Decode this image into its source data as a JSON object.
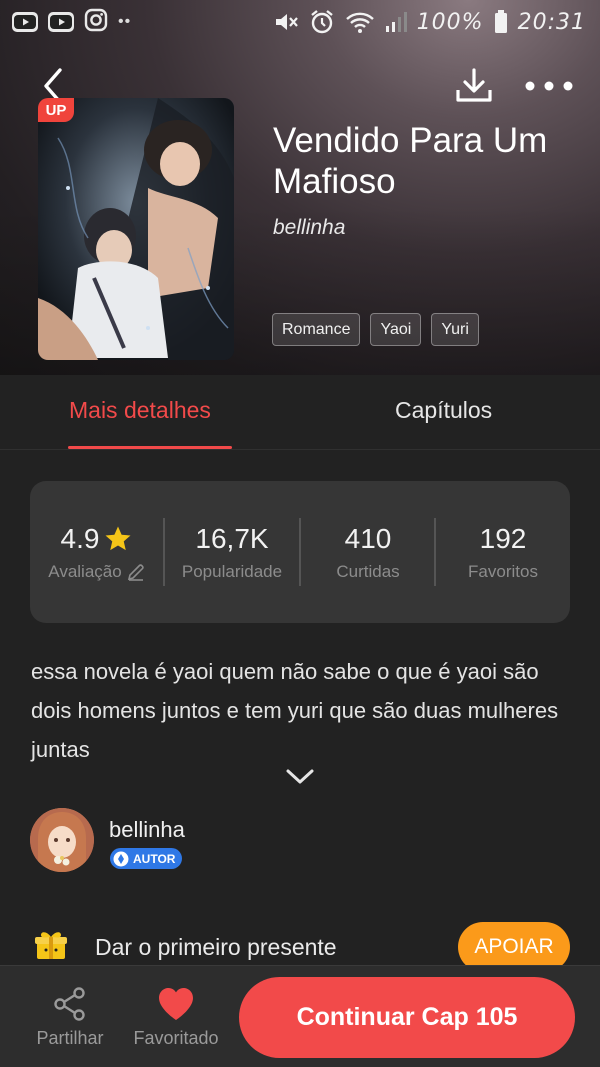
{
  "status_bar": {
    "battery": "100%",
    "time": "20:31",
    "left_icons": [
      "youtube-icon",
      "youtube-icon",
      "instagram-icon",
      "more-notifications-icon"
    ],
    "right_icons": [
      "mute-icon",
      "alarm-icon",
      "wifi-icon",
      "signal-icon",
      "battery-icon"
    ]
  },
  "header": {
    "back_icon": "chevron-left-icon",
    "download_icon": "download-icon",
    "more_icon": "more-dots-icon"
  },
  "book": {
    "badge": "UP",
    "title": "Vendido Para Um Mafioso",
    "author": "bellinha",
    "tags": [
      "Romance",
      "Yaoi",
      "Yuri"
    ]
  },
  "tabs": [
    {
      "label": "Mais detalhes",
      "active": true
    },
    {
      "label": "Capítulos",
      "active": false
    }
  ],
  "stats": [
    {
      "value": "4.9",
      "label": "Avaliação",
      "icon": "star-icon",
      "label_icon": "pencil-icon"
    },
    {
      "value": "16,7K",
      "label": "Popularidade"
    },
    {
      "value": "410",
      "label": "Curtidas"
    },
    {
      "value": "192",
      "label": "Favoritos"
    }
  ],
  "synopsis": "essa novela é yaoi quem não sabe o que é yaoi são dois homens juntos e tem yuri que são duas mulheres juntas",
  "author_card": {
    "name": "bellinha",
    "badge": "AUTOR"
  },
  "gift": {
    "text": "Dar o primeiro presente",
    "button": "APOIAR"
  },
  "bottom_bar": {
    "share_label": "Partilhar",
    "favorite_label": "Favoritado",
    "continue_label": "Continuar Cap 105"
  },
  "colors": {
    "accent": "#f24a4a",
    "apoiar": "#fb9a1a",
    "autor_badge": "#2f78e6",
    "background": "#222222",
    "star": "#f5c518"
  }
}
